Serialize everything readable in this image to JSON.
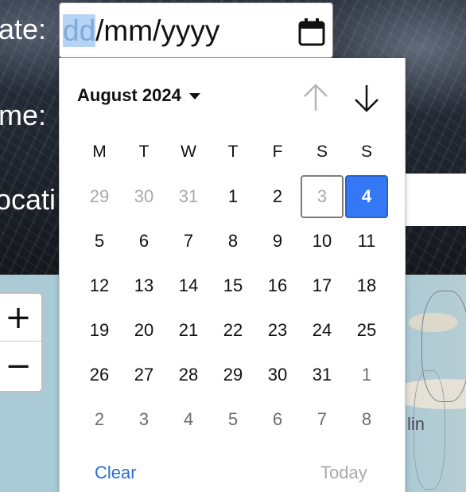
{
  "form": {
    "date_label": "ate:",
    "time_label": "me:",
    "location_label": "ocati"
  },
  "date_input": {
    "segment_day": "dd",
    "rest": "/mm/yyyy",
    "icon": "calendar-icon"
  },
  "picker": {
    "month_label": "August 2024",
    "nav_prev_icon": "arrow-up-icon",
    "nav_next_icon": "arrow-down-icon",
    "weekdays": [
      "M",
      "T",
      "W",
      "T",
      "F",
      "S",
      "S"
    ],
    "weeks": [
      [
        "29",
        "30",
        "31",
        "1",
        "2",
        "3",
        "4"
      ],
      [
        "5",
        "6",
        "7",
        "8",
        "9",
        "10",
        "11"
      ],
      [
        "12",
        "13",
        "14",
        "15",
        "16",
        "17",
        "18"
      ],
      [
        "19",
        "20",
        "21",
        "22",
        "23",
        "24",
        "25"
      ],
      [
        "26",
        "27",
        "28",
        "29",
        "30",
        "31",
        "1"
      ],
      [
        "2",
        "3",
        "4",
        "5",
        "6",
        "7",
        "8"
      ]
    ],
    "selected_day": "4",
    "focused_day": "3",
    "clear_label": "Clear",
    "today_label": "Today",
    "accent_color": "#3478f6"
  },
  "map": {
    "zoom_in_label": "+",
    "zoom_out_label": "−",
    "place_fragment": "lin"
  }
}
